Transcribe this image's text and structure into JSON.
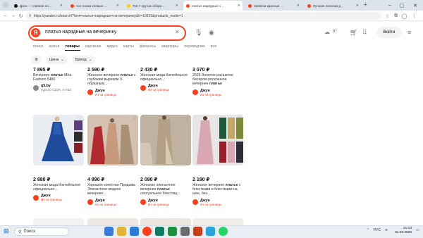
{
  "browser": {
    "tabs": [
      {
        "label": "Дзен — главная новостная...",
        "color": "#111111",
        "active": false
      },
      {
        "label": "топ ложки клевые — Яндекс",
        "color": "#fc3f1d",
        "active": false
      },
      {
        "label": "Топ 7 крутых оборотов ...",
        "color": "#ffcc00",
        "active": false
      },
      {
        "label": "платья нарядные на вечер...",
        "color": "#fc3f1d",
        "active": true
      },
      {
        "label": "пиявочи красные — Яндекс...",
        "color": "#fc3f1d",
        "active": false
      },
      {
        "label": "Лучшие пеленки для лица ...",
        "color": "#fc3f1d",
        "active": false
      }
    ],
    "url": "https://yandex.ru/search/?text=платья+нарядные+на+вечеринку&lr=10916&products_mode=1"
  },
  "search": {
    "logo": "Я",
    "query": "платья нарядные на вечеринку",
    "weather": "8°",
    "login": "Войти"
  },
  "nav_tabs": [
    "поиск",
    "алиса",
    "товары",
    "картинки",
    "видео",
    "карты",
    "финансы",
    "квартиры",
    "переводчик",
    "все"
  ],
  "filters": {
    "price": "Цена",
    "brand": "Бренд"
  },
  "row1": [
    {
      "price": "7 895 ₽",
      "title_pre": "Вечернее ",
      "title_bold": "платье",
      "title_post": " Mira Fashion 5480",
      "shop": "q5.by",
      "shop_sub": "Курьер СДЭК, 8 ПВЗ"
    },
    {
      "price": "2 590 ₽",
      "title_pre": "Женское вечернее ",
      "title_bold": "платье",
      "title_post": " с глубоким вырезом V-образным...",
      "shop": "Джун",
      "shop_sub": "Из-за границы"
    },
    {
      "price": "2 430 ₽",
      "title_pre": "Женская мода Коктейльное официально...",
      "title_bold": "",
      "title_post": "",
      "shop": "Джун",
      "shop_sub": "Из-за границы"
    },
    {
      "price": "3 070 ₽",
      "title_pre": "2025 Золотое расшитое бисером роскошное вечернее ",
      "title_bold": "платье",
      "title_post": "",
      "shop": "Джун",
      "shop_sub": "Из-за границы"
    }
  ],
  "row2": [
    {
      "price": "2 880 ₽",
      "title_pre": "Женская мода Коктейльное официально...",
      "title_bold": "",
      "title_post": "",
      "shop": "Джун",
      "shop_sub": "Из-за границы",
      "dress": "#1f4c9a",
      "bg": "#e9edf2"
    },
    {
      "price": "4 890 ₽",
      "title_pre": "Хорошее качество Продажа Элегантное модное вечернее...",
      "title_bold": "",
      "title_post": "",
      "shop": "Джун",
      "shop_sub": "Из-за границы",
      "dress": "#c79a7e",
      "bg": "#d4c1b1"
    },
    {
      "price": "2 090 ₽",
      "title_pre": "Женское элегантное вечернее ",
      "title_bold": "платье",
      "title_post": " сексуальное блестящ...",
      "shop": "Джун",
      "shop_sub": "Из-за границы",
      "dress": "#b3a087",
      "bg": "#bfb2a0"
    },
    {
      "price": "2 190 ₽",
      "title_pre": "Женское вечернее ",
      "title_bold": "платье",
      "title_post": " с блестками и блестками на шее, без...",
      "shop": "Джун",
      "shop_sub": "Из-за границы",
      "dress": "#d9a6b4",
      "bg": "#e8e6e4"
    }
  ],
  "taskbar": {
    "search": "Поиск",
    "lang": "РУС",
    "time": "21:13",
    "date": "31.03.2025"
  }
}
